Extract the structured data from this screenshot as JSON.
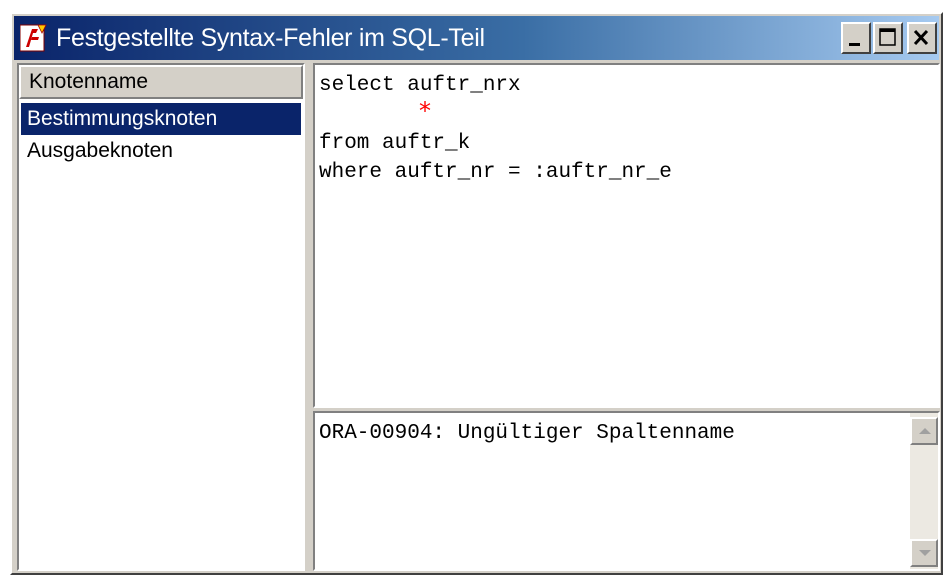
{
  "window": {
    "title": "Festgestellte Syntax-Fehler im SQL-Teil",
    "app_icon": "app-logo-icon",
    "caption_buttons": [
      "minimize-icon",
      "maximize-icon",
      "close-icon"
    ]
  },
  "node_list": {
    "column_header": "Knotenname",
    "items": [
      {
        "label": "Bestimmungsknoten",
        "selected": true
      },
      {
        "label": "Ausgabeknoten",
        "selected": false
      }
    ]
  },
  "sql_editor": {
    "lines": [
      "select auftr_nrx",
      "from auftr_k",
      "where auftr_nr = :auftr_nr_e"
    ],
    "error_marker": "*",
    "marker_color": "#ff0000"
  },
  "message": {
    "text": "ORA-00904: Ungültiger Spaltenname"
  },
  "colors": {
    "titlebar_start": "#0a246a",
    "titlebar_end": "#a6caf0",
    "selection": "#0a246a",
    "window_bg": "#d4d0c8"
  }
}
